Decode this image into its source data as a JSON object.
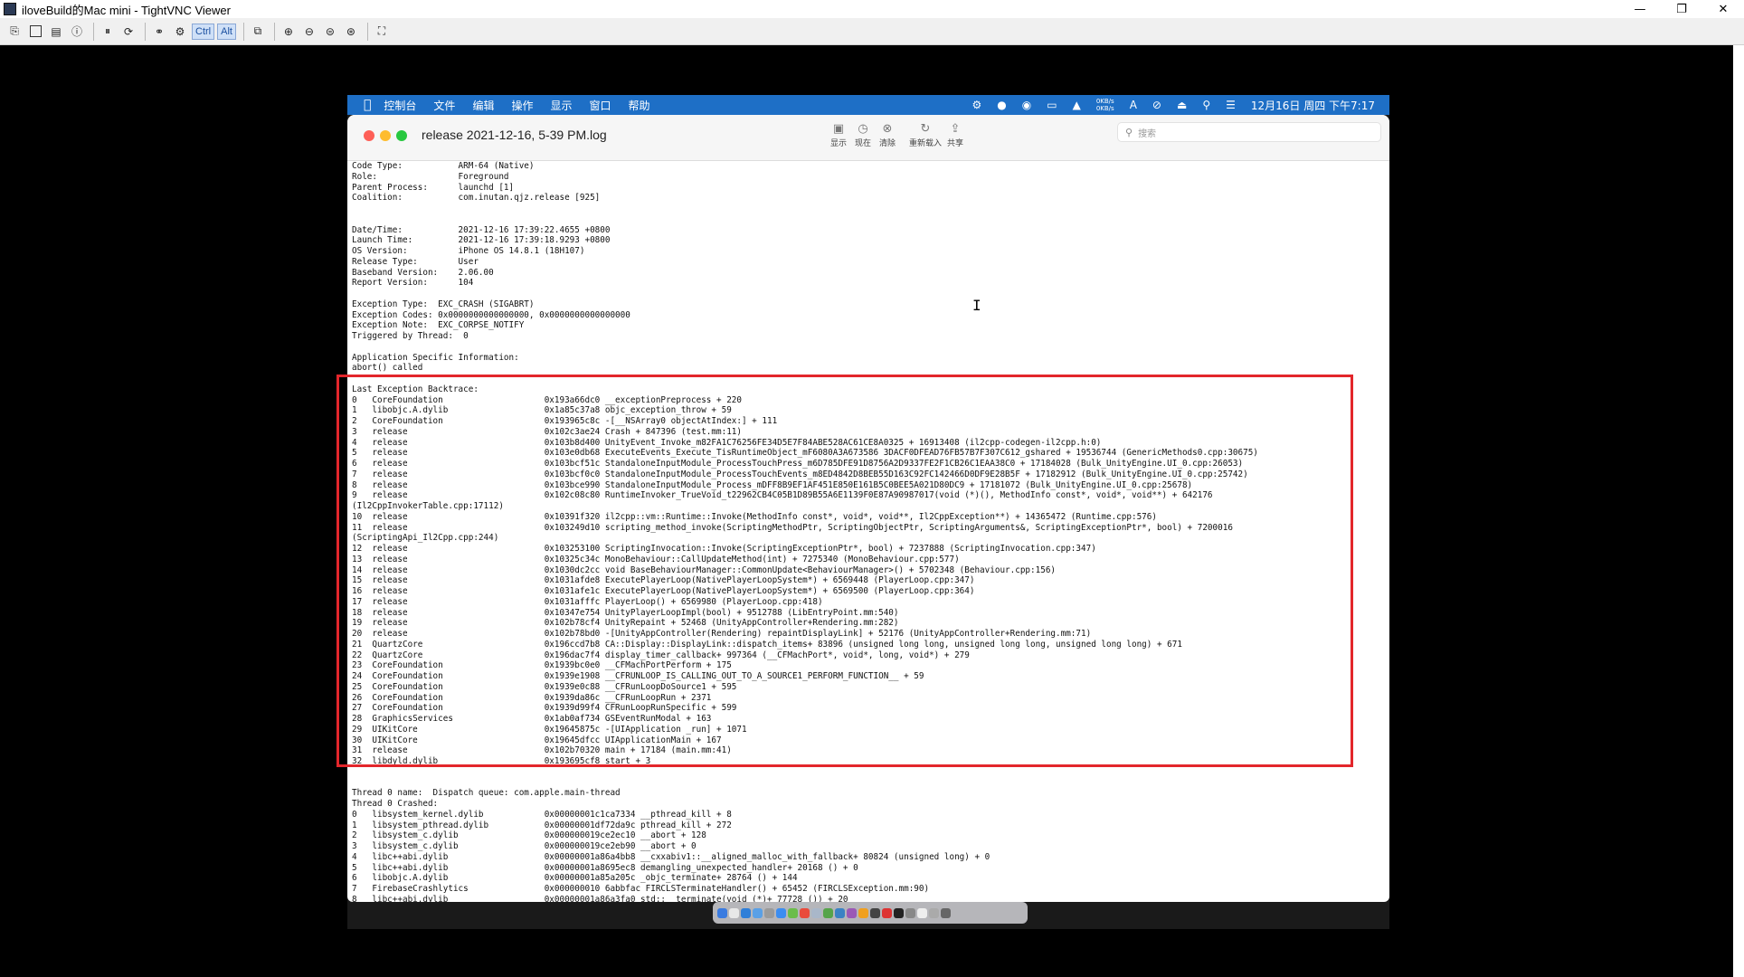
{
  "window": {
    "title": "iloveBuild的Mac mini - TightVNC Viewer",
    "minimize": "—",
    "maximize": "❐",
    "close": "✕"
  },
  "toolbar": {
    "ctrl_label": "Ctrl",
    "alt_label": "Alt"
  },
  "mac_menubar": {
    "apple": "",
    "items": [
      "控制台",
      "文件",
      "编辑",
      "操作",
      "显示",
      "窗口",
      "帮助"
    ],
    "net_up": "0KB/s",
    "net_down": "0KB/s",
    "input_method": "A",
    "clock": "12月16日 周四 下午7:17"
  },
  "console": {
    "title": "release  2021-12-16, 5-39 PM.log",
    "buttons": {
      "show": "显示",
      "now": "现在",
      "clear": "清除",
      "reload": "重新载入",
      "share": "共享"
    },
    "search_placeholder": "搜索"
  },
  "log_lines": [
    "Code Type:           ARM-64 (Native)",
    "Role:                Foreground",
    "Parent Process:      launchd [1]",
    "Coalition:           com.inutan.qjz.release [925]",
    "",
    "",
    "Date/Time:           2021-12-16 17:39:22.4655 +0800",
    "Launch Time:         2021-12-16 17:39:18.9293 +0800",
    "OS Version:          iPhone OS 14.8.1 (18H107)",
    "Release Type:        User",
    "Baseband Version:    2.06.00",
    "Report Version:      104",
    "",
    "Exception Type:  EXC_CRASH (SIGABRT)",
    "Exception Codes: 0x0000000000000000, 0x0000000000000000",
    "Exception Note:  EXC_CORPSE_NOTIFY",
    "Triggered by Thread:  0",
    "",
    "Application Specific Information:",
    "abort() called",
    "",
    "Last Exception Backtrace:",
    "0   CoreFoundation                    0x193a66dc0 __exceptionPreprocess + 220",
    "1   libobjc.A.dylib                   0x1a85c37a8 objc_exception_throw + 59",
    "2   CoreFoundation                    0x193965c8c -[__NSArray0 objectAtIndex:] + 111",
    "3   release                           0x102c3ae24 Crash + 847396 (test.mm:11)",
    "4   release                           0x103b8d400 UnityEvent_Invoke_m82FA1C76256FE34D5E7F84ABE528AC61CE8A0325 + 16913408 (il2cpp-codegen-il2cpp.h:0)",
    "5   release                           0x103e0db68 ExecuteEvents_Execute_TisRuntimeObject_mF6080A3A673586 3DACF0DFEAD76FB57B7F307C612_gshared + 19536744 (GenericMethods0.cpp:30675)",
    "6   release                           0x103bcf51c StandaloneInputModule_ProcessTouchPress_m6D785DFE91D8756A2D9337FE2F1CB26C1EAA38C0 + 17184028 (Bulk_UnityEngine.UI_0.cpp:26053)",
    "7   release                           0x103bcf0c0 StandaloneInputModule_ProcessTouchEvents_m8ED4842D8BEB55D163C92FC142466D0DF9E28B5F + 17182912 (Bulk_UnityEngine.UI_0.cpp:25742)",
    "8   release                           0x103bce990 StandaloneInputModule_Process_mDFF8B9EF1AF451E850E161B5C0BEE5A021D80DC9 + 17181072 (Bulk_UnityEngine.UI_0.cpp:25678)",
    "9   release                           0x102c08c80 RuntimeInvoker_TrueVoid_t22962CB4C05B1D89B55A6E1139F0E87A90987017(void (*)(), MethodInfo const*, void*, void**) + 642176",
    "(Il2CppInvokerTable.cpp:17112)",
    "10  release                           0x10391f320 il2cpp::vm::Runtime::Invoke(MethodInfo const*, void*, void**, Il2CppException**) + 14365472 (Runtime.cpp:576)",
    "11  release                           0x103249d10 scripting_method_invoke(ScriptingMethodPtr, ScriptingObjectPtr, ScriptingArguments&, ScriptingExceptionPtr*, bool) + 7200016",
    "(ScriptingApi_Il2Cpp.cpp:244)",
    "12  release                           0x103253100 ScriptingInvocation::Invoke(ScriptingExceptionPtr*, bool) + 7237888 (ScriptingInvocation.cpp:347)",
    "13  release                           0x10325c34c MonoBehaviour::CallUpdateMethod(int) + 7275340 (MonoBehaviour.cpp:577)",
    "14  release                           0x1030dc2cc void BaseBehaviourManager::CommonUpdate<BehaviourManager>() + 5702348 (Behaviour.cpp:156)",
    "15  release                           0x1031afde8 ExecutePlayerLoop(NativePlayerLoopSystem*) + 6569448 (PlayerLoop.cpp:347)",
    "16  release                           0x1031afe1c ExecutePlayerLoop(NativePlayerLoopSystem*) + 6569500 (PlayerLoop.cpp:364)",
    "17  release                           0x1031afffc PlayerLoop() + 6569980 (PlayerLoop.cpp:418)",
    "18  release                           0x10347e754 UnityPlayerLoopImpl(bool) + 9512788 (LibEntryPoint.mm:540)",
    "19  release                           0x102b78cf4 UnityRepaint + 52468 (UnityAppController+Rendering.mm:282)",
    "20  release                           0x102b78bd0 -[UnityAppController(Rendering) repaintDisplayLink] + 52176 (UnityAppController+Rendering.mm:71)",
    "21  QuartzCore                        0x196ccd7b8 CA::Display::DisplayLink::dispatch_items+ 83896 (unsigned long long, unsigned long long, unsigned long long) + 671",
    "22  QuartzCore                        0x196dac7f4 display_timer_callback+ 997364 (__CFMachPort*, void*, long, void*) + 279",
    "23  CoreFoundation                    0x1939bc0e0 __CFMachPortPerform + 175",
    "24  CoreFoundation                    0x1939e1908 __CFRUNLOOP_IS_CALLING_OUT_TO_A_SOURCE1_PERFORM_FUNCTION__ + 59",
    "25  CoreFoundation                    0x1939e0c88 __CFRunLoopDoSource1 + 595",
    "26  CoreFoundation                    0x1939da86c __CFRunLoopRun + 2371",
    "27  CoreFoundation                    0x1939d99f4 CFRunLoopRunSpecific + 599",
    "28  GraphicsServices                  0x1ab0af734 GSEventRunModal + 163",
    "29  UIKitCore                         0x19645875c -[UIApplication _run] + 1071",
    "30  UIKitCore                         0x19645dfcc UIApplicationMain + 167",
    "31  release                           0x102b70320 main + 17184 (main.mm:41)",
    "32  libdyld.dylib                     0x193695cf8 start + 3",
    "",
    "",
    "Thread 0 name:  Dispatch queue: com.apple.main-thread",
    "Thread 0 Crashed:",
    "0   libsystem_kernel.dylib            0x00000001c1ca7334 __pthread_kill + 8",
    "1   libsystem_pthread.dylib           0x00000001df72da9c pthread_kill + 272",
    "2   libsystem_c.dylib                 0x000000019ce2ec10 __abort + 128",
    "3   libsystem_c.dylib                 0x000000019ce2eb90 __abort + 0",
    "4   libc++abi.dylib                   0x00000001a86a4bb8 __cxxabiv1::__aligned_malloc_with_fallback+ 80824 (unsigned long) + 0",
    "5   libc++abi.dylib                   0x00000001a8695ec8 demangling_unexpected_handler+ 20168 () + 0",
    "6   libobjc.A.dylib                   0x00000001a85a205c _objc_terminate+ 28764 () + 144",
    "7   FirebaseCrashlytics               0x000000010 6abbfac FIRCLSTerminateHandler() + 65452 (FIRCLSException.mm:90)",
    "8   libc++abi.dylib                   0x00000001a86a3fa0 std::__terminate(void (*)+ 77728 ()) + 20"
  ]
}
